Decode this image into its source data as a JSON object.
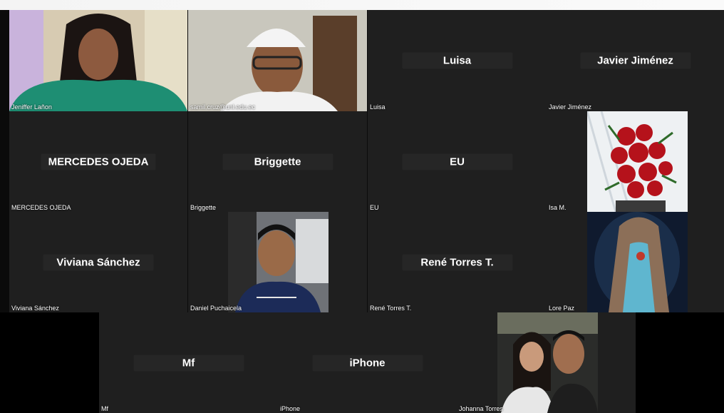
{
  "participants": [
    {
      "name": "Jeniffer Lañon",
      "video": true,
      "icon": "person-video"
    },
    {
      "name": "samil.cruz@unl.edu.ec",
      "video": true,
      "icon": "person-video"
    },
    {
      "name": "Luisa",
      "label": "Luisa",
      "video": false
    },
    {
      "name": "Javier Jiménez",
      "label": "Javier Jiménez",
      "video": false
    },
    {
      "name": "MERCEDES OJEDA",
      "label": "MERCEDES OJEDA",
      "video": false
    },
    {
      "name": "Briggette",
      "label": "Briggette",
      "video": false
    },
    {
      "name": "EU",
      "label": "EU",
      "video": false
    },
    {
      "name": "Isa M.",
      "video": true,
      "icon": "roses-photo"
    },
    {
      "name": "Viviana Sánchez",
      "label": "Viviana Sánchez",
      "video": false
    },
    {
      "name": "Daniel Puchaicela",
      "video": true,
      "icon": "person-video"
    },
    {
      "name": "René Torres T.",
      "label": "René Torres T.",
      "video": false
    },
    {
      "name": "Lore Paz",
      "video": true,
      "icon": "virgin-statue-photo"
    },
    {
      "name": "Mf",
      "label": "Mf",
      "video": false
    },
    {
      "name": "iPhone",
      "label": "iPhone",
      "video": false
    },
    {
      "name": "Johanna Torres",
      "video": true,
      "icon": "couple-photo"
    }
  ]
}
